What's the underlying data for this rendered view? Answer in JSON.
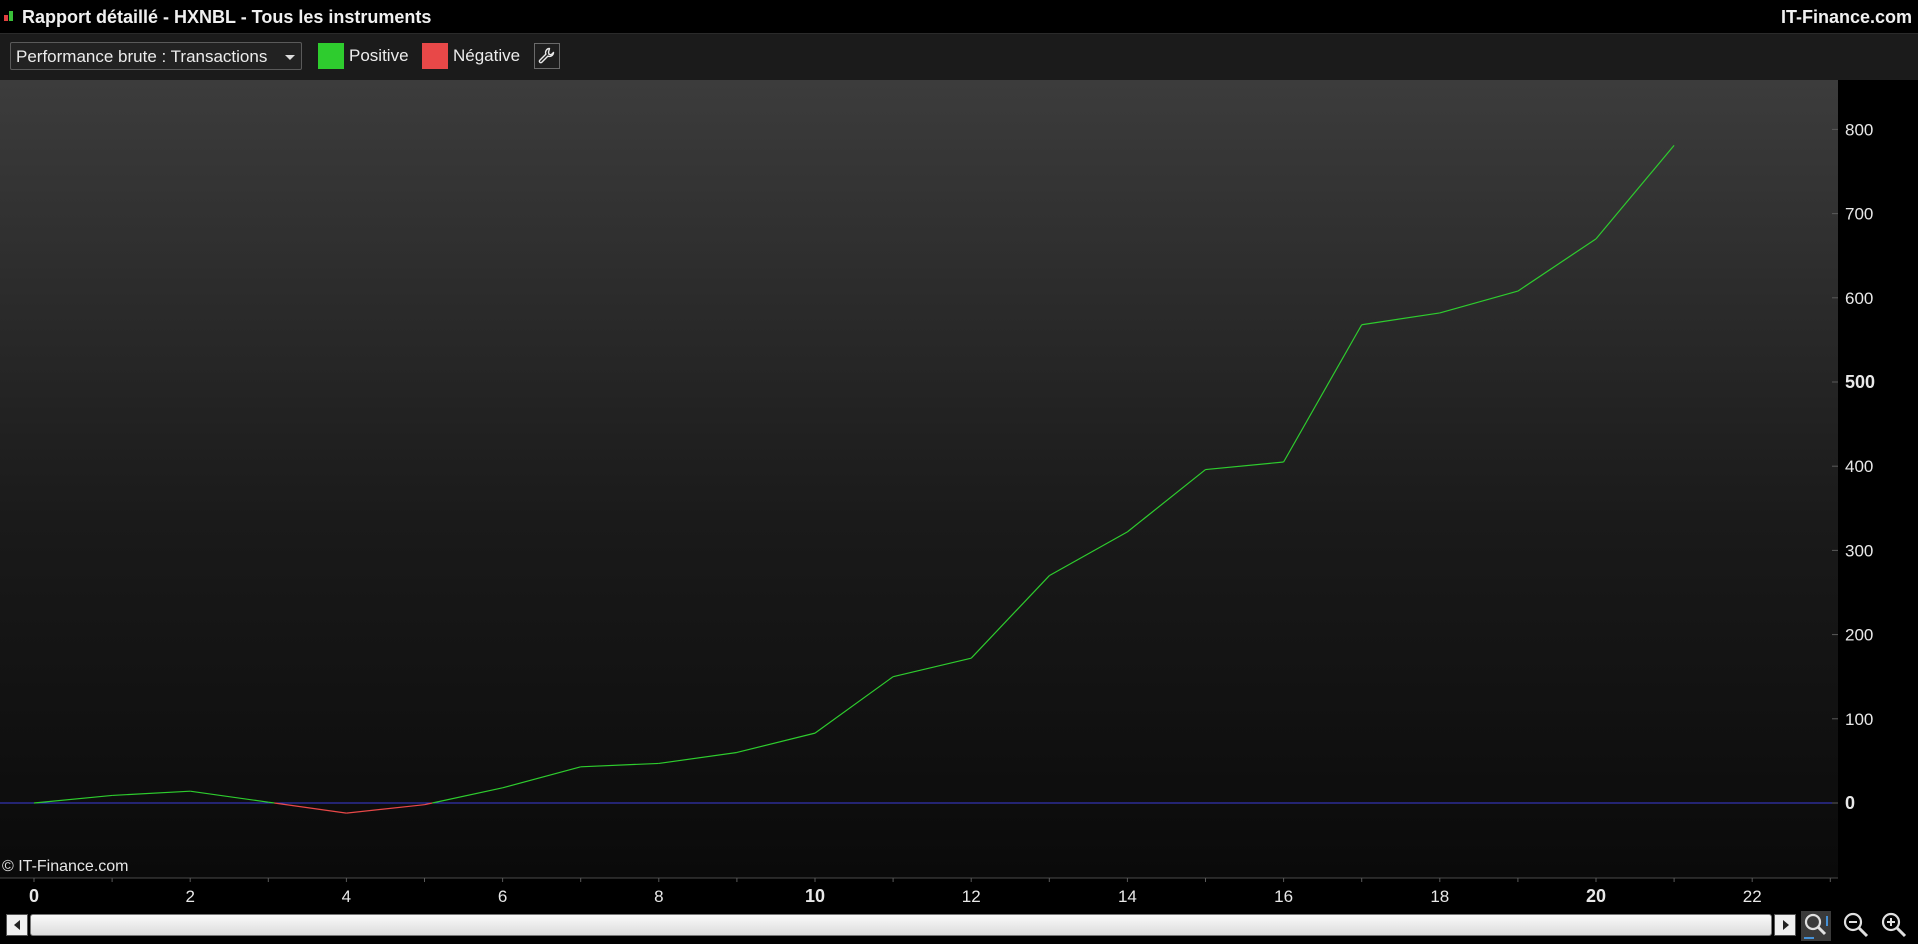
{
  "window": {
    "title": "Rapport détaillé - HXNBL - Tous les instruments",
    "brand": "IT-Finance.com"
  },
  "toolbar": {
    "select_value": "Performance brute : Transactions",
    "legend": [
      {
        "label": "Positive",
        "color": "#2ecc2e"
      },
      {
        "label": "Négative",
        "color": "#e84848"
      }
    ],
    "settings_icon": "wrench-icon"
  },
  "watermark": "© IT-Finance.com",
  "zoom_controls": [
    "zoom-fit-icon",
    "zoom-out-icon",
    "zoom-in-icon"
  ],
  "colors": {
    "positive": "#2ecc2e",
    "negative": "#e84848",
    "zero_line": "#3a3ad8",
    "background_top": "#3c3c3c",
    "background_bottom": "#0a0a0a"
  },
  "chart_data": {
    "type": "line",
    "xlabel": "",
    "ylabel": "",
    "x": [
      0,
      1,
      2,
      3,
      4,
      5,
      6,
      7,
      8,
      9,
      10,
      11,
      12,
      13,
      14,
      15,
      16,
      17,
      18,
      19,
      20,
      21
    ],
    "values": [
      0,
      9,
      14,
      1,
      -12,
      -2,
      18,
      43,
      47,
      60,
      83,
      150,
      172,
      270,
      322,
      396,
      405,
      568,
      582,
      608,
      670,
      781
    ],
    "xlim": [
      0,
      23
    ],
    "ylim": [
      -90,
      870
    ],
    "xticks": [
      0,
      2,
      4,
      6,
      8,
      10,
      12,
      14,
      16,
      18,
      20,
      22
    ],
    "yticks": [
      0,
      100,
      200,
      300,
      400,
      500,
      600,
      700,
      800
    ],
    "bold_xticks": [
      0,
      10,
      20
    ],
    "bold_yticks": [
      0,
      500
    ],
    "zero_line": 0,
    "grid": false,
    "color_rule": "segments above zero in Positive color, below zero in Négative color"
  }
}
